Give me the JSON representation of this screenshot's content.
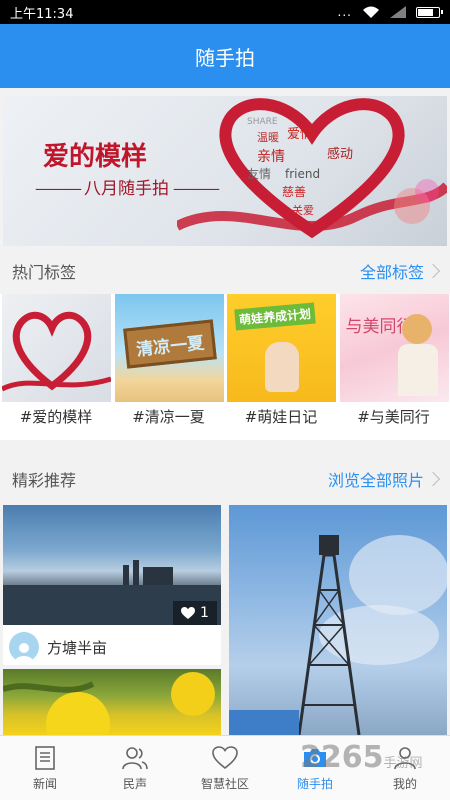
{
  "status_bar": {
    "time": "上午11:34",
    "dots": "..."
  },
  "header": {
    "title": "随手拍"
  },
  "banner": {
    "title": "爱的模样",
    "subtitle": "八月随手拍",
    "words": [
      "温暖",
      "爱情",
      "亲情",
      "感动",
      "友情",
      "friend",
      "慈善",
      "关爱",
      "SHARE"
    ]
  },
  "hot_tags": {
    "title": "热门标签",
    "link": "全部标签",
    "items": [
      {
        "label": "#爱的模样"
      },
      {
        "label": "#清凉一夏",
        "image_text": "清凉一夏"
      },
      {
        "label": "#萌娃日记",
        "image_text": "萌娃养成计划"
      },
      {
        "label": "#与美同行",
        "image_text": "与美同行"
      }
    ]
  },
  "featured": {
    "title": "精彩推荐",
    "link": "浏览全部照片",
    "cards": [
      {
        "likes": "1",
        "author": "方塘半亩"
      }
    ]
  },
  "bottom_nav": {
    "items": [
      {
        "label": "新闻",
        "icon": "newspaper-icon"
      },
      {
        "label": "民声",
        "icon": "people-icon"
      },
      {
        "label": "智慧社区",
        "icon": "heart-icon"
      },
      {
        "label": "随手拍",
        "icon": "camera-icon",
        "active": true
      },
      {
        "label": "我的",
        "icon": "person-icon"
      }
    ]
  },
  "watermark": {
    "text": "2265",
    "suffix": "手游网"
  },
  "colors": {
    "primary": "#2b8ff0",
    "banner_red": "#c0162b"
  }
}
